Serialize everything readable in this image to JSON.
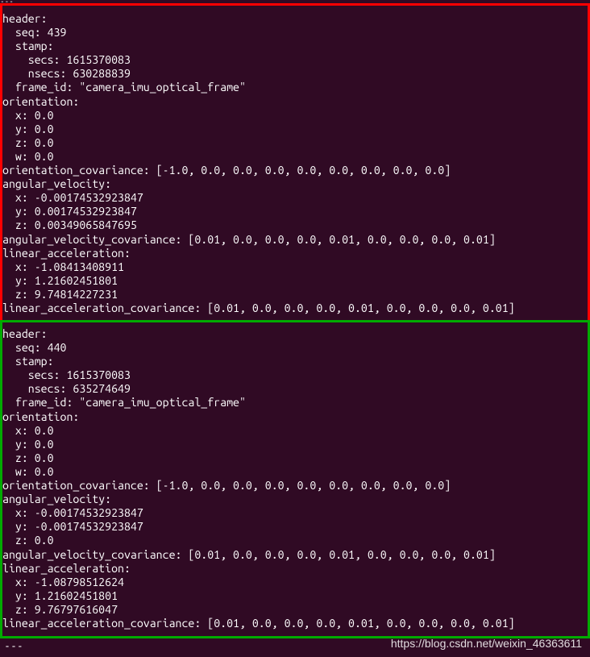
{
  "watermark": "https://blog.csdn.net/weixin_46363611",
  "top_fragment": "---",
  "bottom_fragment": "---",
  "message1": {
    "header_label": "header:",
    "seq_label": "  seq: ",
    "seq_value": "439",
    "stamp_label": "  stamp:",
    "secs_label": "    secs: ",
    "secs_value": "1615370083",
    "nsecs_label": "    nsecs: ",
    "nsecs_value": "630288839",
    "frame_id_label": "  frame_id: ",
    "frame_id_value": "\"camera_imu_optical_frame\"",
    "orientation_label": "orientation:",
    "ox": "  x: 0.0",
    "oy": "  y: 0.0",
    "oz": "  z: 0.0",
    "ow": "  w: 0.0",
    "orientation_cov_label": "orientation_covariance: ",
    "orientation_cov_value": "[-1.0, 0.0, 0.0, 0.0, 0.0, 0.0, 0.0, 0.0, 0.0]",
    "angvel_label": "angular_velocity:",
    "avx": "  x: -0.00174532923847",
    "avy": "  y: 0.00174532923847",
    "avz": "  z: 0.00349065847695",
    "angvel_cov_label": "angular_velocity_covariance: ",
    "angvel_cov_value": "[0.01, 0.0, 0.0, 0.0, 0.01, 0.0, 0.0, 0.0, 0.01]",
    "linacc_label": "linear_acceleration:",
    "lax": "  x: -1.08413408911",
    "lay": "  y: 1.21602451801",
    "laz": "  z: 9.74814227231",
    "linacc_cov_label": "linear_acceleration_covariance: ",
    "linacc_cov_value": "[0.01, 0.0, 0.0, 0.0, 0.01, 0.0, 0.0, 0.0, 0.01]"
  },
  "message2": {
    "header_label": "header:",
    "seq_label": "  seq: ",
    "seq_value": "440",
    "stamp_label": "  stamp:",
    "secs_label": "    secs: ",
    "secs_value": "1615370083",
    "nsecs_label": "    nsecs: ",
    "nsecs_value": "635274649",
    "frame_id_label": "  frame_id: ",
    "frame_id_value": "\"camera_imu_optical_frame\"",
    "orientation_label": "orientation:",
    "ox": "  x: 0.0",
    "oy": "  y: 0.0",
    "oz": "  z: 0.0",
    "ow": "  w: 0.0",
    "orientation_cov_label": "orientation_covariance: ",
    "orientation_cov_value": "[-1.0, 0.0, 0.0, 0.0, 0.0, 0.0, 0.0, 0.0, 0.0]",
    "angvel_label": "angular_velocity:",
    "avx": "  x: -0.00174532923847",
    "avy": "  y: -0.00174532923847",
    "avz": "  z: 0.0",
    "angvel_cov_label": "angular_velocity_covariance: ",
    "angvel_cov_value": "[0.01, 0.0, 0.0, 0.0, 0.01, 0.0, 0.0, 0.0, 0.01]",
    "linacc_label": "linear_acceleration:",
    "lax": "  x: -1.08798512624",
    "lay": "  y: 1.21602451801",
    "laz": "  z: 9.76797616047",
    "linacc_cov_label": "linear_acceleration_covariance: ",
    "linacc_cov_value": "[0.01, 0.0, 0.0, 0.0, 0.01, 0.0, 0.0, 0.0, 0.01]"
  }
}
